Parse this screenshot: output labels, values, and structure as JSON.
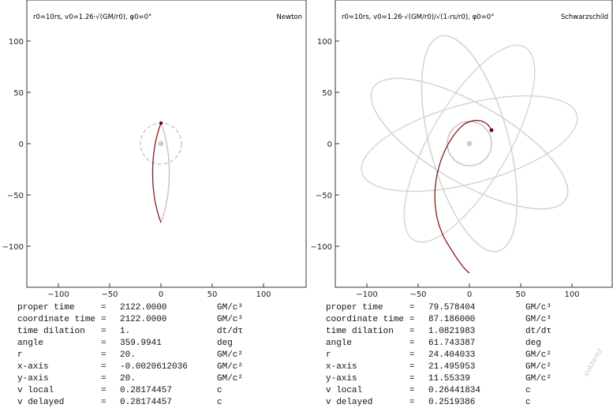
{
  "colors": {
    "frame": "#333333",
    "orbit_past": "#c8c8c8",
    "orbit_trail": "#8b1a1a",
    "orbit_future": "#d9b5b5",
    "horizon_dash": "#b0b0b0",
    "mass": "#cfcfcf"
  },
  "panels": [
    {
      "title": "Newton",
      "subtitle": "r0=10rs, v0=1.26·√(GM/r0), φ0=0°",
      "x_ticks": [
        "−100",
        "−50",
        "0",
        "50",
        "100"
      ],
      "y_ticks": [
        "100",
        "50",
        "0",
        "−50",
        "−100"
      ],
      "readout": [
        {
          "name": "proper time",
          "eq": "=",
          "value": "2122.0000",
          "unit": "GM/c³"
        },
        {
          "name": "coordinate time",
          "eq": "=",
          "value": "2122.0000",
          "unit": "GM/c³"
        },
        {
          "name": "time dilation",
          "eq": "=",
          "value": "1.",
          "unit": "dt/dτ"
        },
        {
          "name": "angle",
          "eq": "=",
          "value": "359.9941",
          "unit": "deg"
        },
        {
          "name": "r",
          "eq": "=",
          "value": "20.",
          "unit": "GM/c²"
        },
        {
          "name": "x-axis",
          "eq": "=",
          "value": "-0.0020612036",
          "unit": "GM/c²"
        },
        {
          "name": "y-axis",
          "eq": "=",
          "value": "20.",
          "unit": "GM/c²"
        },
        {
          "name": "v local",
          "eq": "=",
          "value": "0.28174457",
          "unit": "c"
        },
        {
          "name": "v delayed",
          "eq": "=",
          "value": "0.28174457",
          "unit": "c"
        }
      ]
    },
    {
      "title": "Schwarzschild",
      "subtitle": "r0=10rs, v0=1.26·√(GM/r0)/√(1-rs/r0), φ0=0°",
      "x_ticks": [
        "−100",
        "−50",
        "0",
        "50",
        "100"
      ],
      "y_ticks": [
        "100",
        "50",
        "0",
        "−50",
        "−100"
      ],
      "readout": [
        {
          "name": "proper time",
          "eq": "=",
          "value": "79.578404",
          "unit": "GM/c³"
        },
        {
          "name": "coordinate time",
          "eq": "=",
          "value": "87.186000",
          "unit": "GM/c³"
        },
        {
          "name": "time dilation",
          "eq": "=",
          "value": "1.0821983",
          "unit": "dt/dτ"
        },
        {
          "name": "angle",
          "eq": "=",
          "value": "61.743387",
          "unit": "deg"
        },
        {
          "name": "r",
          "eq": "=",
          "value": "24.404033",
          "unit": "GM/c²"
        },
        {
          "name": "x-axis",
          "eq": "=",
          "value": "21.495953",
          "unit": "GM/c²"
        },
        {
          "name": "y-axis",
          "eq": "=",
          "value": "11.55339",
          "unit": "GM/c²"
        },
        {
          "name": "v local",
          "eq": "=",
          "value": "0.26441834",
          "unit": "c"
        },
        {
          "name": "v delayed",
          "eq": "=",
          "value": "0.2519386",
          "unit": "c"
        }
      ]
    }
  ],
  "watermark": "yukterez"
}
